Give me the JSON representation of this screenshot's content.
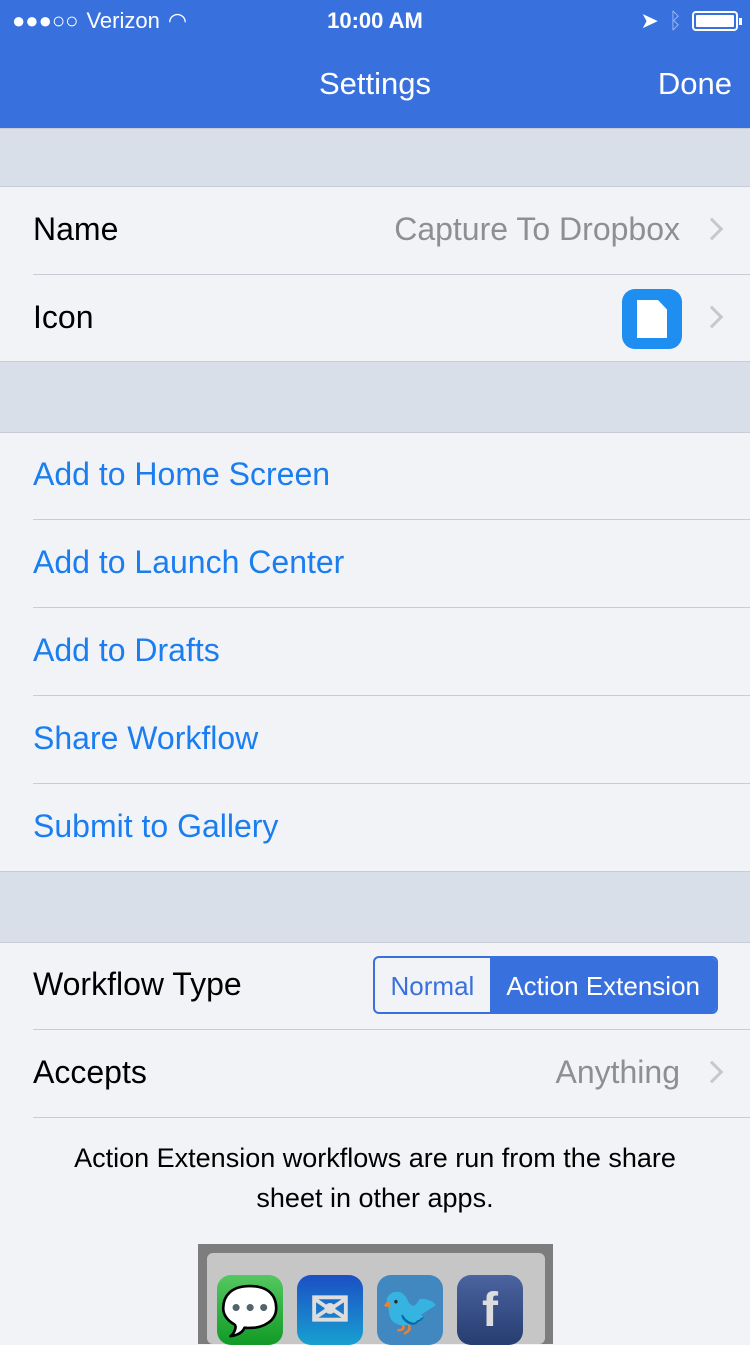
{
  "status": {
    "signal": "●●●○○",
    "carrier": "Verizon",
    "time": "10:00 AM"
  },
  "nav": {
    "title": "Settings",
    "done": "Done"
  },
  "general": {
    "name_label": "Name",
    "name_value": "Capture To Dropbox",
    "icon_label": "Icon",
    "icon_color": "#1e8ef0"
  },
  "actions": [
    "Add to Home Screen",
    "Add to Launch Center",
    "Add to Drafts",
    "Share Workflow",
    "Submit to Gallery"
  ],
  "type": {
    "label": "Workflow Type",
    "options": [
      "Normal",
      "Action Extension"
    ],
    "selected": "Action Extension",
    "accepts_label": "Accepts",
    "accepts_value": "Anything"
  },
  "note": "Action Extension workflows are run from the share sheet in other apps.",
  "share_sheet_apps": [
    "messages-icon",
    "mail-icon",
    "twitter-icon",
    "facebook-icon"
  ],
  "colors": {
    "accent": "#3871de",
    "link": "#1a7ef0"
  }
}
